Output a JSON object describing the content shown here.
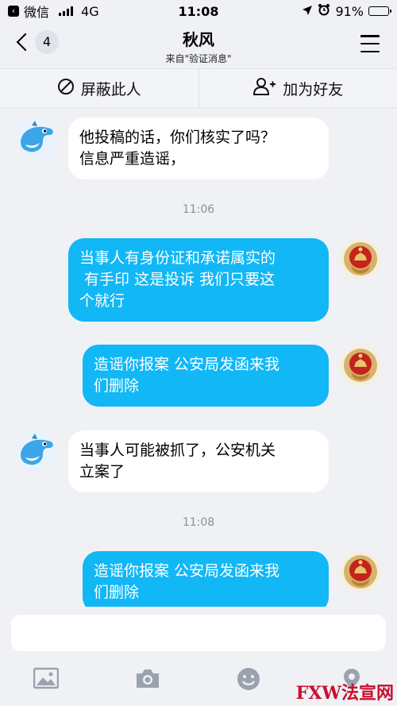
{
  "status_bar": {
    "carrier": "微信",
    "network": "4G",
    "time": "11:08",
    "battery": "91%",
    "battery_level": 0.91
  },
  "nav": {
    "unread_count": "4",
    "title": "秋风",
    "subtitle": "来自\"验证消息\""
  },
  "actions": {
    "block_label": "屏蔽此人",
    "add_friend_label": "加为好友"
  },
  "messages": [
    {
      "type": "in",
      "text_lines": [
        "他投稿的话，你们核实了吗？",
        "信息严重造谣，"
      ]
    },
    {
      "type": "time",
      "text": "11:06"
    },
    {
      "type": "out",
      "text_lines": [
        "当事人有身份证和承诺属实的",
        " 有手印 这是投诉 我们只要这",
        "个就行"
      ]
    },
    {
      "type": "out",
      "text_lines": [
        "造谣你报案 公安局发函来我",
        "们删除"
      ]
    },
    {
      "type": "in",
      "text_lines": [
        "当事人可能被抓了，公安机关",
        "立案了"
      ]
    },
    {
      "type": "time",
      "text": "11:08"
    },
    {
      "type": "out",
      "text_lines": [
        "造谣你报案 公安局发函来我",
        "们删除"
      ]
    }
  ],
  "composer": {
    "placeholder": ""
  },
  "toolbar": {
    "icons": [
      "image-icon",
      "camera-icon",
      "emoji-icon",
      "location-icon"
    ]
  },
  "watermark": {
    "part1": "FXW",
    "part2": "法宣网"
  },
  "colors": {
    "outgoing_bubble": "#12b7f5",
    "incoming_bubble": "#ffffff",
    "background": "#eff1f5"
  }
}
